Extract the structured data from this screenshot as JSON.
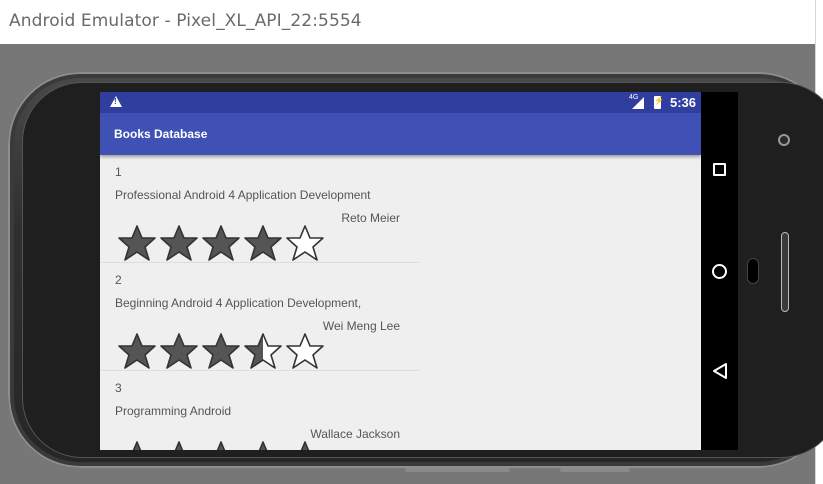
{
  "window": {
    "title": "Android Emulator - Pixel_XL_API_22:5554"
  },
  "status_bar": {
    "time": "5:36",
    "network": "4G",
    "icons": [
      "warning-icon",
      "signal-icon",
      "battery-icon"
    ]
  },
  "app_bar": {
    "title": "Books Database"
  },
  "books": [
    {
      "number": "1",
      "title": "Professional Android 4 Application Development",
      "author": "Reto Meier",
      "rating": 4,
      "max_rating": 5
    },
    {
      "number": "2",
      "title": "Beginning Android 4 Application Development,",
      "author": "Wei Meng Lee",
      "rating": 3.5,
      "max_rating": 5
    },
    {
      "number": "3",
      "title": "Programming Android",
      "author": "Wallace Jackson",
      "rating": 5,
      "max_rating": 5
    }
  ],
  "nav_bar": {
    "icons": [
      "recents-icon",
      "home-icon",
      "back-icon"
    ]
  },
  "colors": {
    "app_bar": "#3f51b5",
    "status_bar": "#303f9f",
    "star_fill": "#555555",
    "star_outline": "#333333"
  }
}
